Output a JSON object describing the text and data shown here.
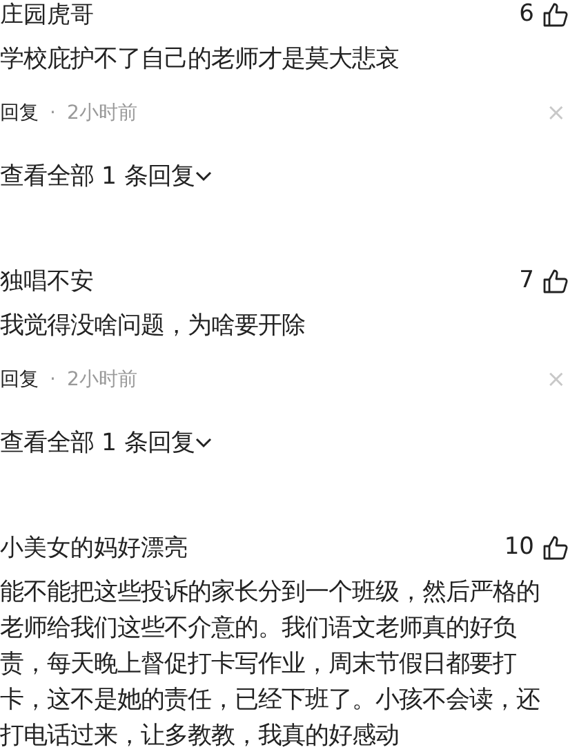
{
  "comments": [
    {
      "name": "庄园虎哥",
      "likes": "6",
      "text": "学校庇护不了自己的老师才是莫大悲哀",
      "reply": "回复",
      "separator": "·",
      "time": "2小时前",
      "close": "×",
      "view_all": "查看全部 1 条回复"
    },
    {
      "name": "独唱不安",
      "likes": "7",
      "text": "我觉得没啥问题，为啥要开除",
      "reply": "回复",
      "separator": "·",
      "time": "2小时前",
      "close": "×",
      "view_all": "查看全部 1 条回复"
    },
    {
      "name": "小美女的妈好漂亮",
      "likes": "10",
      "text": "能不能把这些投诉的家长分到一个班级，然后严格的老师给我们这些不介意的。我们语文老师真的好负责，每天晚上督促打卡写作业，周末节假日都要打卡，这不是她的责任，已经下班了。小孩不会读，还打电话过来，让多教教，我真的好感动"
    }
  ]
}
